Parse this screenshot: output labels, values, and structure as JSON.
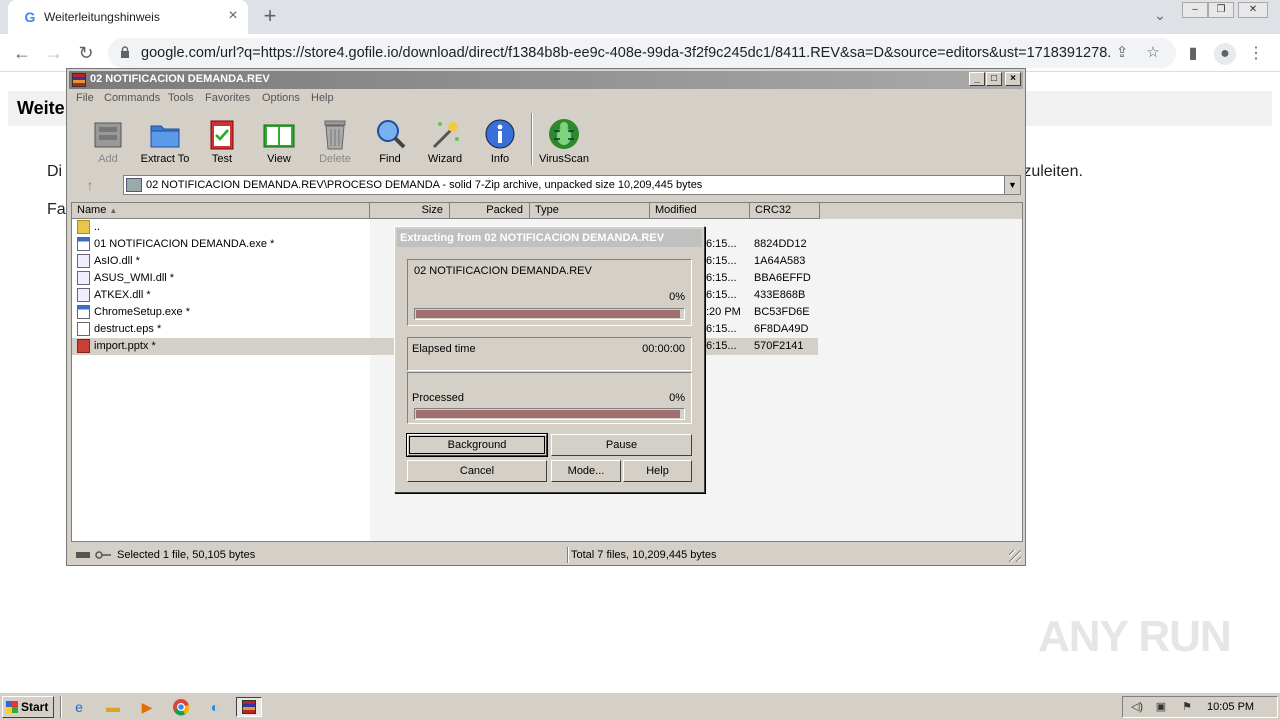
{
  "browser": {
    "tab_title": "Weiterleitungshinweis",
    "favicon": "G",
    "url": "google.com/url?q=https://store4.gofile.io/download/direct/f1384b8b-ee9c-408e-99da-3f2f9c245dc1/8411.REV&sa=D&source=editors&ust=1718391278..."
  },
  "page": {
    "heading": "Weite",
    "line1_start": "Di",
    "line1_end": "rzuleiten.",
    "line2_start": "Fa"
  },
  "winrar": {
    "title": "02 NOTIFICACION DEMANDA.REV",
    "menu": [
      "File",
      "Commands",
      "Tools",
      "Favorites",
      "Options",
      "Help"
    ],
    "tools": [
      {
        "label": "Add",
        "icon": "add-archive-icon",
        "enabled": false
      },
      {
        "label": "Extract To",
        "icon": "extract-folder-icon",
        "enabled": true
      },
      {
        "label": "Test",
        "icon": "test-clipboard-icon",
        "enabled": true
      },
      {
        "label": "View",
        "icon": "view-book-icon",
        "enabled": true
      },
      {
        "label": "Delete",
        "icon": "trash-icon",
        "enabled": false
      },
      {
        "label": "Find",
        "icon": "magnifier-icon",
        "enabled": true
      },
      {
        "label": "Wizard",
        "icon": "wand-icon",
        "enabled": true
      },
      {
        "label": "Info",
        "icon": "info-icon",
        "enabled": true
      },
      {
        "label": "VirusScan",
        "icon": "bug-icon",
        "enabled": true
      }
    ],
    "path": "02 NOTIFICACION DEMANDA.REV\\PROCESO DEMANDA - solid 7-Zip archive, unpacked size 10,209,445 bytes",
    "columns": [
      "Name",
      "Size",
      "Packed",
      "Type",
      "Modified",
      "CRC32"
    ],
    "rows": [
      {
        "name": "..",
        "icon": "folder",
        "modified": "",
        "crc": ""
      },
      {
        "name": "01 NOTIFICACION DEMANDA.exe *",
        "icon": "exe",
        "modified": "6:15...",
        "crc": "8824DD12"
      },
      {
        "name": "AsIO.dll *",
        "icon": "dll",
        "modified": "6:15...",
        "crc": "1A64A583"
      },
      {
        "name": "ASUS_WMI.dll *",
        "icon": "dll",
        "modified": "6:15...",
        "crc": "BBA6EFFD"
      },
      {
        "name": "ATKEX.dll *",
        "icon": "dll",
        "modified": "6:15...",
        "crc": "433E868B"
      },
      {
        "name": "ChromeSetup.exe *",
        "icon": "exe",
        "modified": ":20 PM",
        "crc": "BC53FD6E"
      },
      {
        "name": "destruct.eps *",
        "icon": "generic",
        "modified": "6:15...",
        "crc": "6F8DA49D"
      },
      {
        "name": "import.pptx *",
        "icon": "pptx",
        "modified": "6:15...",
        "crc": "570F2141",
        "selected": true
      }
    ],
    "status_left": "Selected 1 file, 50,105 bytes",
    "status_right": "Total 7 files, 10,209,445 bytes"
  },
  "dialog": {
    "title": "Extracting from 02 NOTIFICACION DEMANDA.REV",
    "archive": "02 NOTIFICACION DEMANDA.REV",
    "file_percent": "0%",
    "file_progress": 0.99,
    "elapsed_label": "Elapsed time",
    "elapsed_value": "00:00:00",
    "processed_label": "Processed",
    "processed_percent": "0%",
    "processed_progress": 0.99,
    "buttons": {
      "background": "Background",
      "pause": "Pause",
      "cancel": "Cancel",
      "mode": "Mode...",
      "help": "Help"
    }
  },
  "watermark": "ANY RUN",
  "taskbar": {
    "start": "Start",
    "clock": "10:05 PM"
  }
}
